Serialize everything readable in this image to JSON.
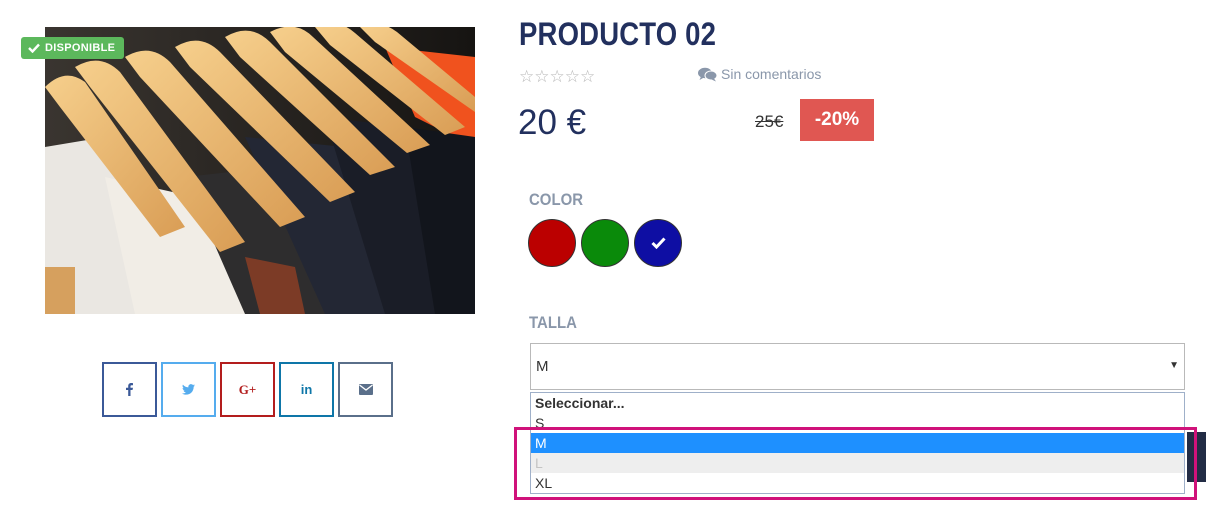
{
  "product": {
    "title": "PRODUCTO 02",
    "badge": "DISPONIBLE",
    "rating_stars": "☆☆☆☆☆",
    "comments": "Sin comentarios",
    "price": "20 €",
    "old_price": "25€",
    "discount": "-20%"
  },
  "color": {
    "label": "COLOR",
    "swatches": [
      {
        "color": "#bb0000",
        "selected": false
      },
      {
        "color": "#0a8a0a",
        "selected": false
      },
      {
        "color": "#0e0ea3",
        "selected": true
      }
    ]
  },
  "size": {
    "label": "TALLA",
    "current_value": "M",
    "options": [
      {
        "label": "Seleccionar...",
        "state": "group"
      },
      {
        "label": "S",
        "state": "normal"
      },
      {
        "label": "M",
        "state": "selected"
      },
      {
        "label": "L",
        "state": "disabled"
      },
      {
        "label": "XL",
        "state": "normal"
      }
    ]
  },
  "share": [
    {
      "icon": "facebook-icon",
      "color": "#3b5998"
    },
    {
      "icon": "twitter-icon",
      "color": "#55acee"
    },
    {
      "icon": "google-plus-icon",
      "color": "#b31d1d"
    },
    {
      "icon": "linkedin-icon",
      "color": "#0e76a8"
    },
    {
      "icon": "envelope-icon",
      "color": "#5a6f8a"
    }
  ],
  "colors": {
    "title": "#22305e",
    "muted": "#8a97aa",
    "badge": "#5cb85c",
    "discount": "#e05752",
    "highlight": "#d0127a"
  }
}
